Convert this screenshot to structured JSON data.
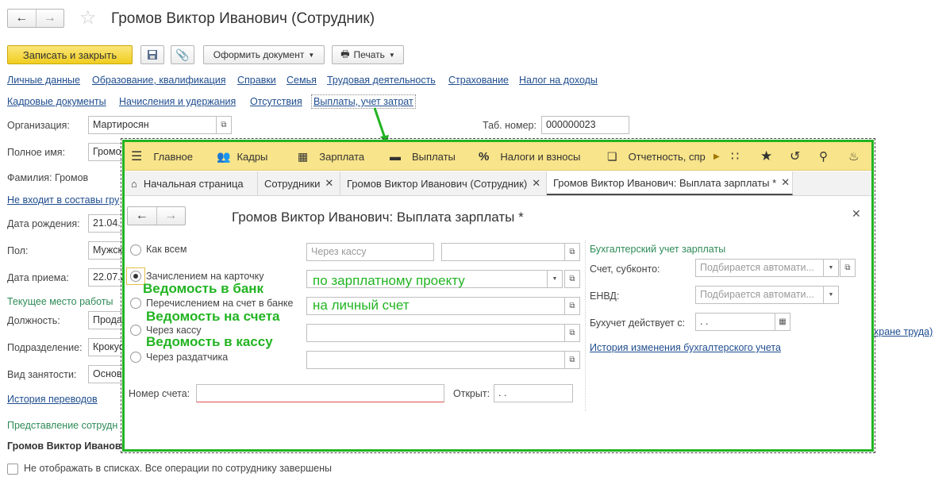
{
  "header": {
    "title": "Громов Виктор Иванович (Сотрудник)",
    "back_icon": "arrow-left-icon",
    "forward_icon": "arrow-right-icon",
    "star_icon": "star-icon"
  },
  "toolbar": {
    "save_close": "Записать и закрыть",
    "document": "Оформить документ",
    "print": "Печать"
  },
  "links_row1": [
    "Личные данные",
    "Образование, квалификация",
    "Справки",
    "Семья",
    "Трудовая деятельность",
    "Страхование",
    "Налог на доходы"
  ],
  "links_row2": [
    "Кадровые документы",
    "Начисления и удержания",
    "Отсутствия",
    "Выплаты, учет затрат"
  ],
  "form": {
    "org_label": "Организация:",
    "org_value": "Мартиросян",
    "tab_label": "Таб. номер:",
    "tab_value": "000000023",
    "fullname_label": "Полное имя:",
    "fullname_value": "Громо",
    "surname_text": "Фамилия:  Громов",
    "group_link": "Не входит в составы гру",
    "birth_label": "Дата рождения:",
    "birth_value": "21.04.",
    "sex_label": "Пол:",
    "sex_value": "Мужск",
    "hire_label": "Дата приема:",
    "hire_value": "22.07.2",
    "workplace_header": "Текущее место работы",
    "position_label": "Должность:",
    "position_value": "Прода",
    "dept_label": "Подразделение:",
    "dept_value": "Крокус",
    "emptype_label": "Вид занятости:",
    "emptype_value": "Основ",
    "transfer_history": "История переводов",
    "repr_header": "Представление сотрудн",
    "repr_value": "Громов Виктор Иванови",
    "labor_link": "хране труда)",
    "hide_checkbox": "Не отображать в списках. Все операции по сотруднику завершены"
  },
  "popup": {
    "menu": {
      "main": "Главное",
      "hr": "Кадры",
      "salary": "Зарплата",
      "payments": "Выплаты",
      "taxes": "Налоги и взносы",
      "reports": "Отчетность, спр"
    },
    "tabs": [
      "Начальная страница",
      "Сотрудники",
      "Громов Виктор Иванович (Сотрудник)",
      "Громов Виктор Иванович: Выплата зарплаты *"
    ],
    "title": "Громов Виктор Иванович: Выплата зарплаты *",
    "options": [
      "Как всем",
      "Зачислением на карточку",
      "Перечислением на счет в банке",
      "Через кассу",
      "Через раздатчика"
    ],
    "cash_placeholder": "Через кассу",
    "project_value": "по зарплатному проекту",
    "personal_value": "на личный счет",
    "account_label": "Номер счета:",
    "opened_label": "Открыт:",
    "opened_value": " .  .",
    "acc_header": "Бухгалтерский учет зарплаты",
    "subconto_label": "Счет, субконто:",
    "auto_placeholder": "Подбирается автомати...",
    "envd_label": "ЕНВД:",
    "valid_label": "Бухучет действует с:",
    "valid_value": " .  .",
    "acc_history": "История изменения бухгалтерского учета"
  },
  "annotations": {
    "bank": "Ведомость в банк",
    "accounts": "Ведомость на счета",
    "cash": "Ведомость в кассу"
  },
  "colors": {
    "accent_yellow": "#f5d735",
    "annotation_green": "#22b422",
    "link_blue": "#1f4d8f"
  }
}
